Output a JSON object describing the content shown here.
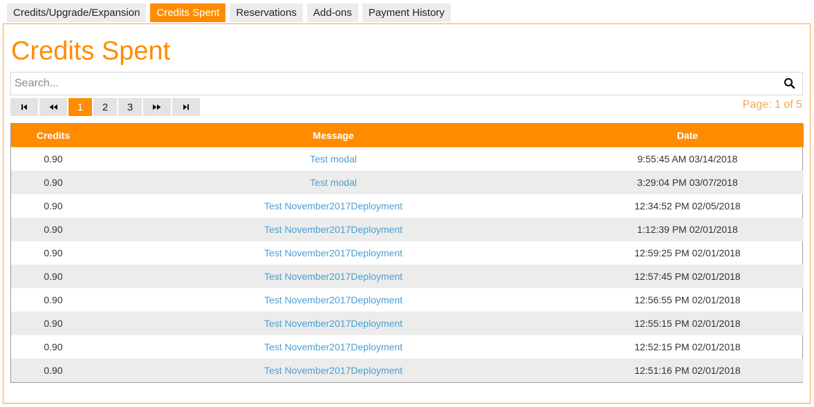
{
  "tabs": [
    {
      "label": "Credits/Upgrade/Expansion",
      "active": false
    },
    {
      "label": "Credits Spent",
      "active": true
    },
    {
      "label": "Reservations",
      "active": false
    },
    {
      "label": "Add-ons",
      "active": false
    },
    {
      "label": "Payment History",
      "active": false
    }
  ],
  "title": "Credits Spent",
  "search": {
    "placeholder": "Search...",
    "value": "",
    "icon": "search-icon"
  },
  "pager": {
    "icons": [
      "first-page-icon",
      "previous-page-icon",
      "next-page-icon",
      "last-page-icon"
    ],
    "pages": [
      "1",
      "2",
      "3"
    ],
    "current": "1",
    "info": "Page: 1 of 5"
  },
  "table": {
    "columns": [
      "Credits",
      "Message",
      "Date"
    ],
    "rows": [
      {
        "credits": "0.90",
        "message": "Test modal",
        "date": "9:55:45 AM 03/14/2018"
      },
      {
        "credits": "0.90",
        "message": "Test modal",
        "date": "3:29:04 PM 03/07/2018"
      },
      {
        "credits": "0.90",
        "message": "Test November2017Deployment",
        "date": "12:34:52 PM 02/05/2018"
      },
      {
        "credits": "0.90",
        "message": "Test November2017Deployment",
        "date": "1:12:39 PM 02/01/2018"
      },
      {
        "credits": "0.90",
        "message": "Test November2017Deployment",
        "date": "12:59:25 PM 02/01/2018"
      },
      {
        "credits": "0.90",
        "message": "Test November2017Deployment",
        "date": "12:57:45 PM 02/01/2018"
      },
      {
        "credits": "0.90",
        "message": "Test November2017Deployment",
        "date": "12:56:55 PM 02/01/2018"
      },
      {
        "credits": "0.90",
        "message": "Test November2017Deployment",
        "date": "12:55:15 PM 02/01/2018"
      },
      {
        "credits": "0.90",
        "message": "Test November2017Deployment",
        "date": "12:52:15 PM 02/01/2018"
      },
      {
        "credits": "0.90",
        "message": "Test November2017Deployment",
        "date": "12:51:16 PM 02/01/2018"
      }
    ]
  },
  "colors": {
    "accent": "#ff8c00",
    "link": "#4a9fd6",
    "row_alt": "#ececec"
  }
}
